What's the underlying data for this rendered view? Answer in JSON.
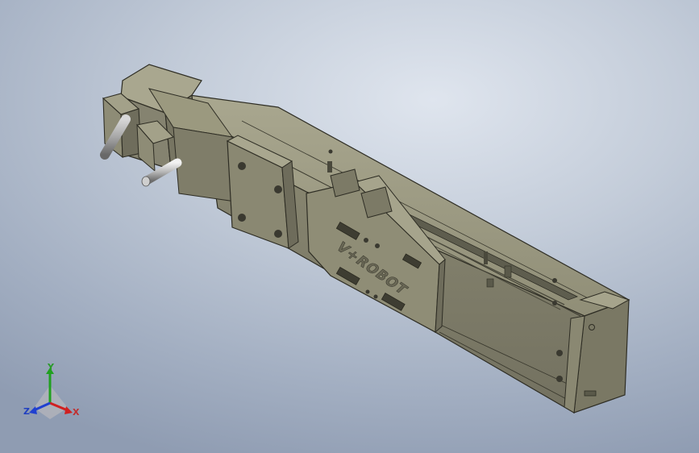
{
  "view": {
    "background_colors": {
      "center": "#dfe5ee",
      "edge": "#8f9cb2"
    }
  },
  "model": {
    "body_color": "#8c8a72",
    "engraving": "V+ROBOT"
  },
  "triad": {
    "y_label": "Y",
    "x_label": "X",
    "z_label": "Z",
    "colors": {
      "x": "#d02020",
      "y": "#20a020",
      "z": "#2040d0"
    }
  }
}
